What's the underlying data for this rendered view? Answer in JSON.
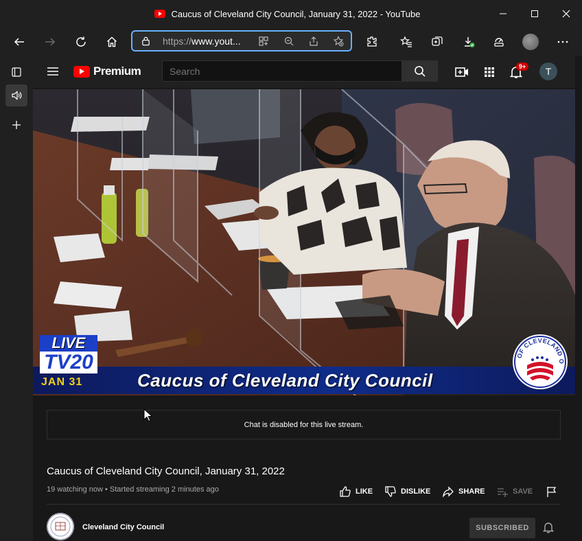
{
  "window": {
    "title": "Caucus of Cleveland City Council, January 31, 2022 - YouTube",
    "controls": [
      "minimize-icon",
      "maximize-icon",
      "close-icon"
    ]
  },
  "browser": {
    "address": {
      "scheme": "https://",
      "host": "www.yout..."
    },
    "toolbar_icons": [
      "back-icon",
      "forward-icon",
      "refresh-icon",
      "home-icon",
      "lock-icon",
      "app-icon",
      "zoom-out-icon",
      "share-icon",
      "add-favorite-icon",
      "extensions-icon",
      "favorites-icon",
      "collections-icon",
      "downloads-icon",
      "performance-icon",
      "profile-avatar",
      "more-icon"
    ],
    "vertical_tabs": [
      "tab-actions-icon",
      "audio-tab-icon",
      "new-tab-icon"
    ]
  },
  "youtube": {
    "logo_text": "Premium",
    "search": {
      "placeholder": "Search"
    },
    "notifications_badge": "9+",
    "user_initial": "T"
  },
  "video": {
    "overlay": {
      "live": "LIVE",
      "channel": "TV20",
      "date": "JAN 31",
      "caption": "Caucus of Cleveland City Council",
      "seal_text": "CITY OF CLEVELAND OHIO"
    }
  },
  "chat": {
    "message": "Chat is disabled for this live stream."
  },
  "info": {
    "title": "Caucus of Cleveland City Council, January 31, 2022",
    "meta": "19 watching now • Started streaming 2 minutes ago",
    "actions": {
      "like": "LIKE",
      "dislike": "DISLIKE",
      "share": "SHARE",
      "save": "SAVE"
    },
    "channel_name": "Cleveland City Council",
    "subscribe_label": "SUBSCRIBED"
  },
  "colors": {
    "accent_blue": "#6ab0ff",
    "youtube_red": "#ff0000",
    "badge_red": "#cc0000",
    "overlay_blue": "#1c3fc7",
    "overlay_yellow": "#f7d117"
  }
}
